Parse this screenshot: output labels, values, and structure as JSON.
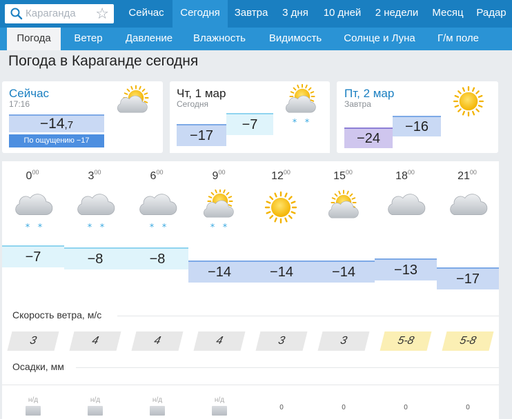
{
  "search": {
    "placeholder": "Караганда"
  },
  "topnav": [
    "Сейчас",
    "Сегодня",
    "Завтра",
    "3 дня",
    "10 дней",
    "2 недели",
    "Месяц",
    "Радар"
  ],
  "subnav": [
    "Погода",
    "Ветер",
    "Давление",
    "Влажность",
    "Видимость",
    "Солнце и Луна",
    "Г/м поле"
  ],
  "page_title": "Погода в Караганде сегодня",
  "now": {
    "label": "Сейчас",
    "time": "17:16",
    "temp_int": "−14",
    "temp_dec": ",7",
    "feels": "По ощущению −17"
  },
  "today": {
    "label": "Чт, 1 мар",
    "sub": "Сегодня",
    "low": "−17",
    "high": "−7"
  },
  "tomorrow": {
    "label": "Пт, 2 мар",
    "sub": "Завтра",
    "low": "−24",
    "high": "−16"
  },
  "hours": [
    {
      "h": "0",
      "icon": "cloud-snow-icon",
      "temp": "−7",
      "value": -7,
      "wind": "3",
      "precip": "н/д"
    },
    {
      "h": "3",
      "icon": "cloud-snow-icon",
      "temp": "−8",
      "value": -8,
      "wind": "4",
      "precip": "н/д"
    },
    {
      "h": "6",
      "icon": "cloud-snow-icon",
      "temp": "−8",
      "value": -8,
      "wind": "4",
      "precip": "н/д"
    },
    {
      "h": "9",
      "icon": "sun-cloud-snow-icon",
      "temp": "−14",
      "value": -14,
      "wind": "4",
      "precip": "н/д"
    },
    {
      "h": "12",
      "icon": "sun-icon",
      "temp": "−14",
      "value": -14,
      "wind": "3",
      "precip": "0"
    },
    {
      "h": "15",
      "icon": "sun-cloud-icon",
      "temp": "−14",
      "value": -14,
      "wind": "3",
      "precip": "0"
    },
    {
      "h": "18",
      "icon": "cloud-icon",
      "temp": "−13",
      "value": -13,
      "wind": "5-8",
      "precip": "0"
    },
    {
      "h": "21",
      "icon": "cloud-icon",
      "temp": "−17",
      "value": -17,
      "wind": "5-8",
      "precip": "0"
    }
  ],
  "hour_suffix": "00",
  "wind_label": "Скорость ветра, м/с",
  "precip_label": "Осадки, мм",
  "colors": {
    "nav": "#1a7fc1",
    "nav_active": "#2a93d5",
    "warm_band": "#dff4fb",
    "cold_band": "#c9d9f4",
    "very_cold": "#cfc6ee",
    "wind_gray": "#e8e8e8",
    "wind_yellow": "#fbefb4"
  }
}
